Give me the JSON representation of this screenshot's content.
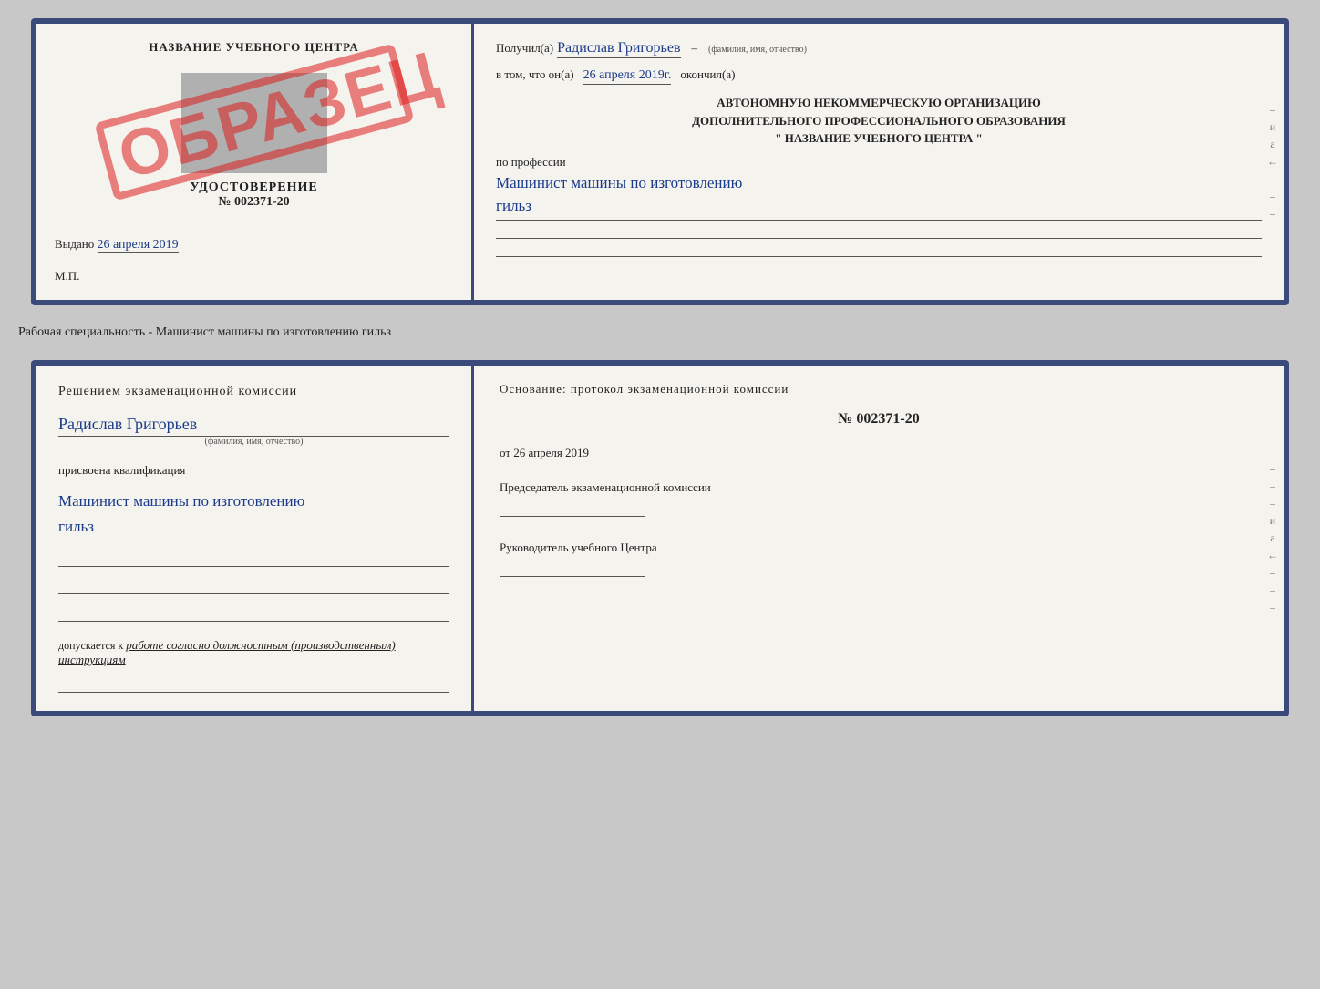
{
  "top_document": {
    "left": {
      "center_title": "НАЗВАНИЕ УЧЕБНОГО ЦЕНТРА",
      "stamp_label": "УДОСТОВЕРЕНИЕ",
      "stamp_number": "№ 002371-20",
      "obrazec": "ОБРАЗЕЦ",
      "vydano": "Выдано",
      "vydano_date": "26 апреля 2019",
      "mp": "М.П."
    },
    "right": {
      "poluchil_prefix": "Получил(а)",
      "recipient_name": "Радислав Григорьев",
      "fio_label": "(фамилия, имя, отчество)",
      "vtom_prefix": "в том, что он(а)",
      "vtom_date": "26 апреля 2019г.",
      "okончил": "окончил(а)",
      "org_line1": "АВТОНОМНУЮ НЕКОММЕРЧЕСКУЮ ОРГАНИЗАЦИЮ",
      "org_line2": "ДОПОЛНИТЕЛЬНОГО ПРОФЕССИОНАЛЬНОГО ОБРАЗОВАНИЯ",
      "org_line3": "\" НАЗВАНИЕ УЧЕБНОГО ЦЕНТРА \"",
      "po_professii": "по профессии",
      "profession_line1": "Машинист машины по изготовлению",
      "profession_line2": "гильз"
    }
  },
  "separator": {
    "text": "Рабочая специальность - Машинист машины по изготовлению гильз"
  },
  "bottom_document": {
    "left": {
      "komissia_text": "Решением  экзаменационной  комиссии",
      "name": "Радислав Григорьев",
      "fio_label": "(фамилия, имя, отчество)",
      "prisvoena": "присвоена квалификация",
      "qual_line1": "Машинист машины по изготовлению",
      "qual_line2": "гильз",
      "dopuskaetsya_prefix": "допускается к",
      "dopuskaetsya_text": "работе согласно должностным (производственным) инструкциям"
    },
    "right": {
      "osnov_text": "Основание: протокол экзаменационной  комиссии",
      "protocol_number": "№ 002371-20",
      "ot_prefix": "от",
      "protocol_date": "26 апреля 2019",
      "predsedatel_label": "Председатель экзаменационной комиссии",
      "rukovoditel_label": "Руководитель учебного Центра"
    }
  },
  "vertical_marks": [
    "-",
    "и",
    "а",
    "←",
    "-",
    "-",
    "-"
  ]
}
